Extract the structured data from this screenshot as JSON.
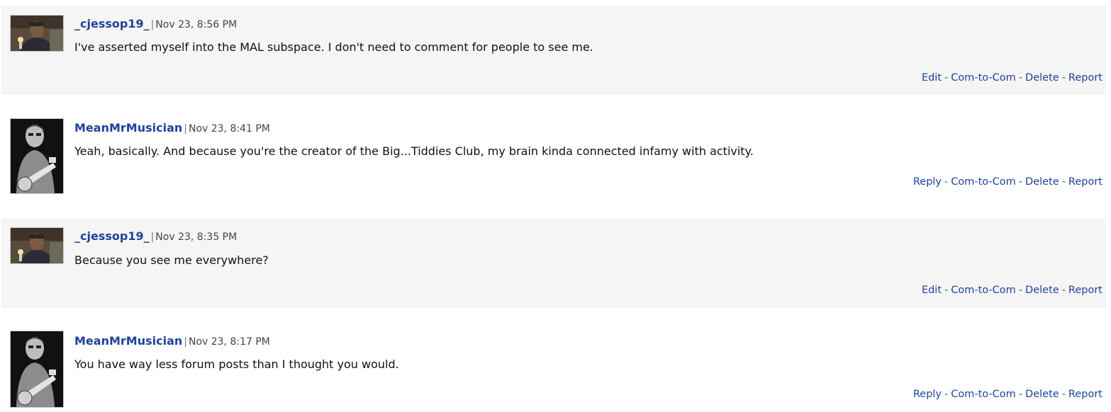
{
  "comments": [
    {
      "username": "_cjessop19_",
      "timestamp": "Nov 23, 8:56 PM",
      "text": "I've asserted myself into the MAL subspace. I don't need to comment for people to see me.",
      "actions": [
        "Edit",
        "Com-to-Com",
        "Delete",
        "Report"
      ],
      "separator": "|",
      "action_separator": "-"
    },
    {
      "username": "MeanMrMusician",
      "timestamp": "Nov 23, 8:41 PM",
      "text": "Yeah, basically. And because you're the creator of the Big...Tiddies Club, my brain kinda connected infamy with activity.",
      "actions": [
        "Reply",
        "Com-to-Com",
        "Delete",
        "Report"
      ],
      "separator": "|",
      "action_separator": "-"
    },
    {
      "username": "_cjessop19_",
      "timestamp": "Nov 23, 8:35 PM",
      "text": "Because you see me everywhere?",
      "actions": [
        "Edit",
        "Com-to-Com",
        "Delete",
        "Report"
      ],
      "separator": "|",
      "action_separator": "-"
    },
    {
      "username": "MeanMrMusician",
      "timestamp": "Nov 23, 8:17 PM",
      "text": "You have way less forum posts than I thought you would.",
      "actions": [
        "Reply",
        "Com-to-Com",
        "Delete",
        "Report"
      ],
      "separator": "|",
      "action_separator": "-"
    }
  ],
  "colors": {
    "link": "#1d439b",
    "shaded_row": "#f5f5f5",
    "text": "#111111",
    "meta": "#444444"
  }
}
